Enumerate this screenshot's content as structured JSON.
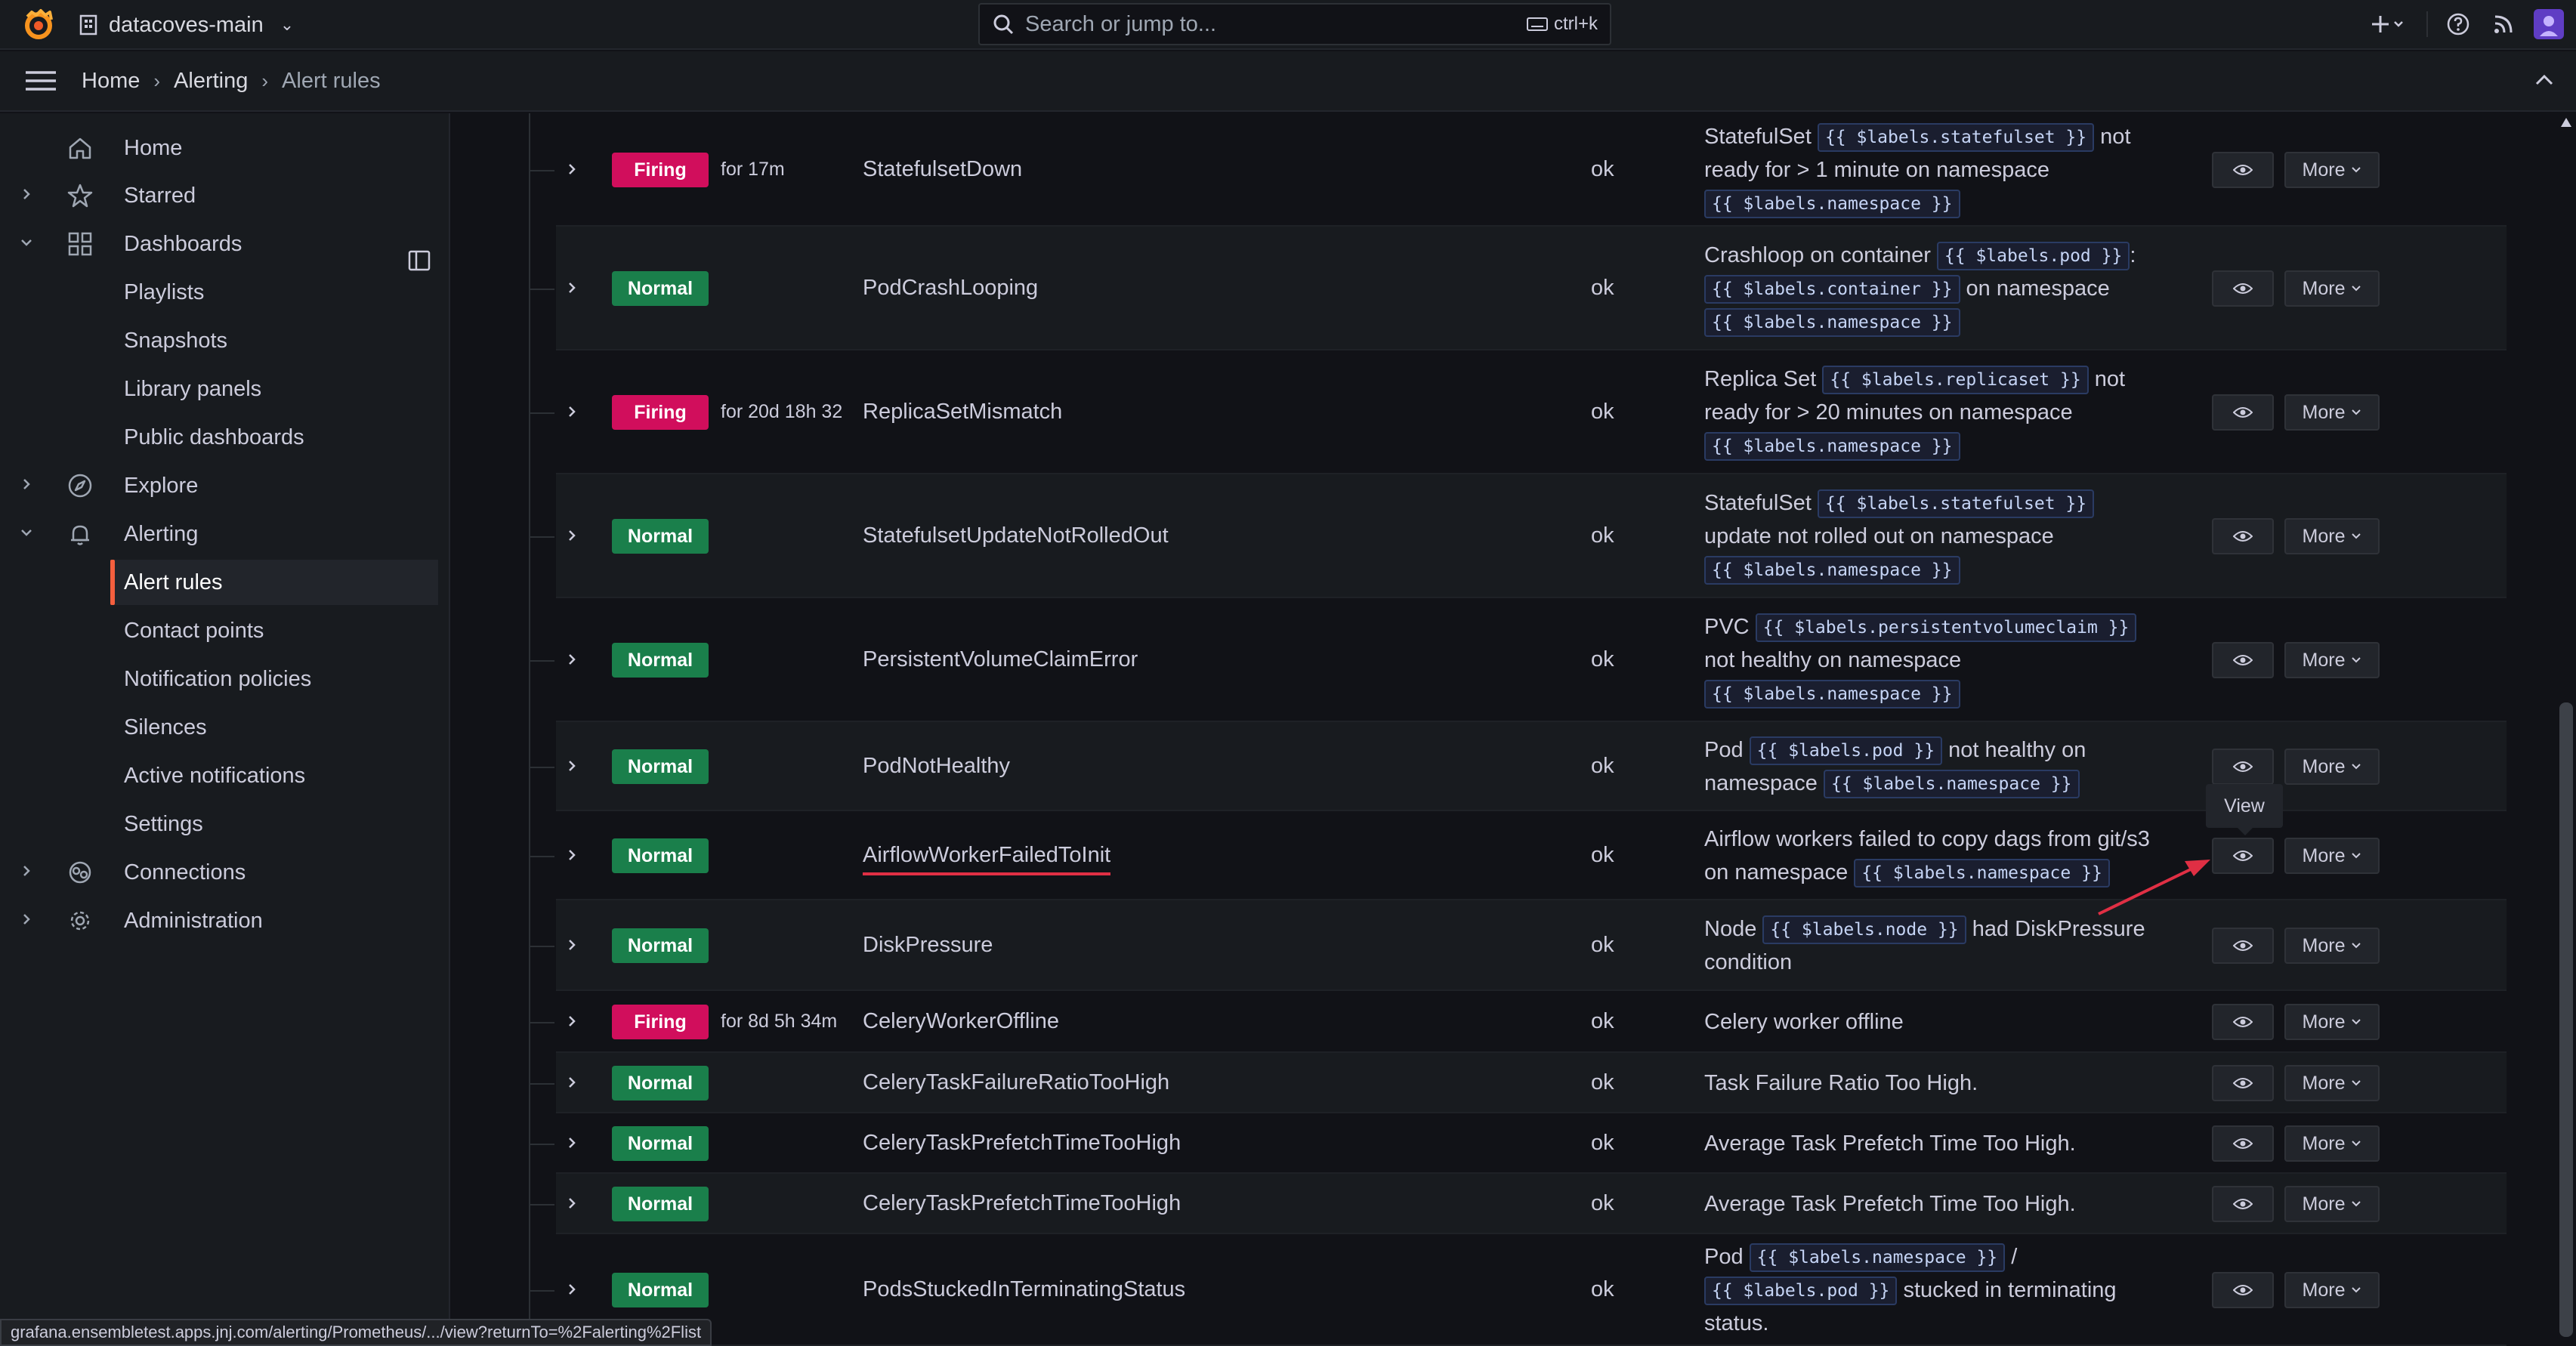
{
  "topbar": {
    "org_name": "datacoves-main",
    "search_placeholder": "Search or jump to...",
    "search_shortcut": "ctrl+k",
    "plus_label": "+"
  },
  "breadcrumb": [
    {
      "label": "Home"
    },
    {
      "label": "Alerting"
    },
    {
      "label": "Alert rules"
    }
  ],
  "sidebar": {
    "items": [
      {
        "label": "Home",
        "icon": "home-icon",
        "expand": "none"
      },
      {
        "label": "Starred",
        "icon": "star-icon",
        "expand": "collapsed"
      },
      {
        "label": "Dashboards",
        "icon": "dashboards-icon",
        "expand": "expanded"
      },
      {
        "label": "Playlists",
        "expand": "child"
      },
      {
        "label": "Snapshots",
        "expand": "child"
      },
      {
        "label": "Library panels",
        "expand": "child"
      },
      {
        "label": "Public dashboards",
        "expand": "child"
      },
      {
        "label": "Explore",
        "icon": "compass-icon",
        "expand": "collapsed"
      },
      {
        "label": "Alerting",
        "icon": "bell-icon",
        "expand": "expanded"
      },
      {
        "label": "Alert rules",
        "expand": "active"
      },
      {
        "label": "Contact points",
        "expand": "child"
      },
      {
        "label": "Notification policies",
        "expand": "child"
      },
      {
        "label": "Silences",
        "expand": "child"
      },
      {
        "label": "Active notifications",
        "expand": "child"
      },
      {
        "label": "Settings",
        "expand": "child"
      },
      {
        "label": "Connections",
        "icon": "connections-icon",
        "expand": "collapsed"
      },
      {
        "label": "Administration",
        "icon": "gear-icon",
        "expand": "collapsed"
      }
    ]
  },
  "rules": [
    {
      "state": "Firing",
      "since": "for 17m",
      "name": "StatefulsetDown",
      "health": "ok",
      "summary": [
        [
          "StatefulSet ",
          "{{ $labels.statefulset }}",
          " not"
        ],
        [
          "ready for > 1 minute on namespace"
        ],
        [
          "{{ $labels.namespace }}"
        ]
      ]
    },
    {
      "state": "Normal",
      "since": "",
      "name": "PodCrashLooping",
      "health": "ok",
      "summary": [
        [
          "Crashloop on container ",
          "{{ $labels.pod }}",
          ":"
        ],
        [
          "{{ $labels.container }}",
          " on namespace"
        ],
        [
          "{{ $labels.namespace }}"
        ]
      ]
    },
    {
      "state": "Firing",
      "since": "for 20d 18h 32",
      "name": "ReplicaSetMismatch",
      "health": "ok",
      "summary": [
        [
          "Replica Set ",
          "{{ $labels.replicaset }}",
          " not"
        ],
        [
          "ready for > 20 minutes on namespace"
        ],
        [
          "{{ $labels.namespace }}"
        ]
      ]
    },
    {
      "state": "Normal",
      "since": "",
      "name": "StatefulsetUpdateNotRolledOut",
      "health": "ok",
      "summary": [
        [
          "StatefulSet ",
          "{{ $labels.statefulset }}"
        ],
        [
          "update not rolled out on namespace"
        ],
        [
          "{{ $labels.namespace }}"
        ]
      ]
    },
    {
      "state": "Normal",
      "since": "",
      "name": "PersistentVolumeClaimError",
      "health": "ok",
      "summary": [
        [
          "PVC ",
          "{{ $labels.persistentvolumeclaim }}"
        ],
        [
          "not healthy on namespace"
        ],
        [
          "{{ $labels.namespace }}"
        ]
      ]
    },
    {
      "state": "Normal",
      "since": "",
      "name": "PodNotHealthy",
      "health": "ok",
      "summary": [
        [
          "Pod ",
          "{{ $labels.pod }}",
          " not healthy on"
        ],
        [
          "namespace ",
          "{{ $labels.namespace }}"
        ]
      ]
    },
    {
      "state": "Normal",
      "since": "",
      "name": "AirflowWorkerFailedToInit",
      "health": "ok",
      "highlight": true,
      "summary": [
        [
          "Airflow workers failed to copy dags from git/s3"
        ],
        [
          "on namespace ",
          "{{ $labels.namespace }}"
        ]
      ]
    },
    {
      "state": "Normal",
      "since": "",
      "name": "DiskPressure",
      "health": "ok",
      "summary": [
        [
          "Node ",
          "{{ $labels.node }}",
          " had DiskPressure"
        ],
        [
          "condition"
        ]
      ]
    },
    {
      "state": "Firing",
      "since": "for 8d 5h 34m",
      "name": "CeleryWorkerOffline",
      "health": "ok",
      "summary": [
        [
          "Celery worker offline"
        ]
      ]
    },
    {
      "state": "Normal",
      "since": "",
      "name": "CeleryTaskFailureRatioTooHigh",
      "health": "ok",
      "summary": [
        [
          "Task Failure Ratio Too High."
        ]
      ]
    },
    {
      "state": "Normal",
      "since": "",
      "name": "CeleryTaskPrefetchTimeTooHigh",
      "health": "ok",
      "summary": [
        [
          "Average Task Prefetch Time Too High."
        ]
      ]
    },
    {
      "state": "Normal",
      "since": "",
      "name": "CeleryTaskPrefetchTimeTooHigh",
      "health": "ok",
      "summary": [
        [
          "Average Task Prefetch Time Too High."
        ]
      ]
    },
    {
      "state": "Normal",
      "since": "",
      "name": "PodsStuckedInTerminatingStatus",
      "health": "ok",
      "summary": [
        [
          "Pod ",
          "{{ $labels.namespace }}",
          " /"
        ],
        [
          "{{ $labels.pod }}",
          " stucked in terminating"
        ],
        [
          "status."
        ]
      ]
    }
  ],
  "actions": {
    "more_label": "More",
    "view_tooltip": "View"
  },
  "status_url": "grafana.ensembletest.apps.jnj.com/alerting/Prometheus/.../view?returnTo=%2Falerting%2Flist",
  "colors": {
    "firing": "#d10e5c",
    "normal": "#1a7f4b",
    "accent": "#f55f3e",
    "annotation": "#e02f44"
  }
}
